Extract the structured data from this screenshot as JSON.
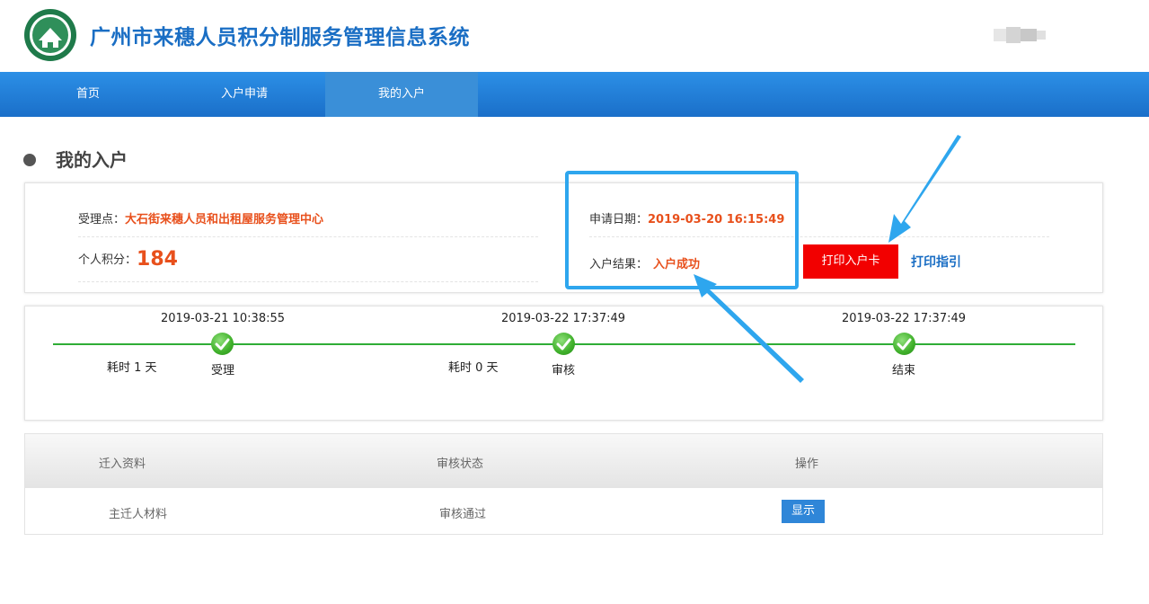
{
  "header": {
    "logo_icon": "city-emblem-icon",
    "title": "广州市来穗人员积分制服务管理信息系统"
  },
  "nav": {
    "items": [
      {
        "label": "首页"
      },
      {
        "label": "入户申请"
      },
      {
        "label": "我的入户",
        "active": true
      }
    ]
  },
  "section": {
    "title": "我的入户"
  },
  "info": {
    "office_label": "受理点：",
    "office_value": "大石街来穗人员和出租屋服务管理中心",
    "score_label": "个人积分：",
    "score_value": "184",
    "date_label": "申请日期：",
    "date_value": "2019-03-20 16:15:49",
    "result_label": "入户结果：",
    "result_value": "入户成功",
    "print_card_button": "打印入户卡",
    "print_guide_link": "打印指引"
  },
  "timeline": {
    "steps": [
      {
        "time": "2019-03-21 10:38:55",
        "label": "受理"
      },
      {
        "time": "2019-03-22 17:37:49",
        "label": "审核"
      },
      {
        "time": "2019-03-22 17:37:49",
        "label": "结束"
      }
    ],
    "durations": [
      "耗时 1 天",
      "耗时 0 天"
    ]
  },
  "table": {
    "headers": [
      "迁入资料",
      "审核状态",
      "操作"
    ],
    "rows": [
      {
        "material": "主迁人材料",
        "status": "审核通过",
        "action": "显示"
      }
    ]
  },
  "colors": {
    "brand_blue": "#1a6ec4",
    "accent_orange": "#e8501c",
    "print_red": "#f20000",
    "success_green": "#2fad36",
    "annotation_blue": "#2ea6ee"
  }
}
